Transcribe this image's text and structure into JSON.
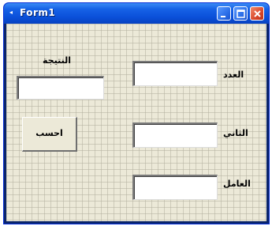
{
  "window": {
    "title": "Form1",
    "title_bar_color": "#0a4fd8",
    "close_color": "#d9482b",
    "client_color": "#ece9d8"
  },
  "labels": {
    "result": "النتيجة",
    "first": "العدد",
    "second": "الثاني",
    "operator": "العامل"
  },
  "button": {
    "label": "احسب"
  },
  "inputs": {
    "result_value": "",
    "first_value": "",
    "second_value": "",
    "operator_value": ""
  }
}
